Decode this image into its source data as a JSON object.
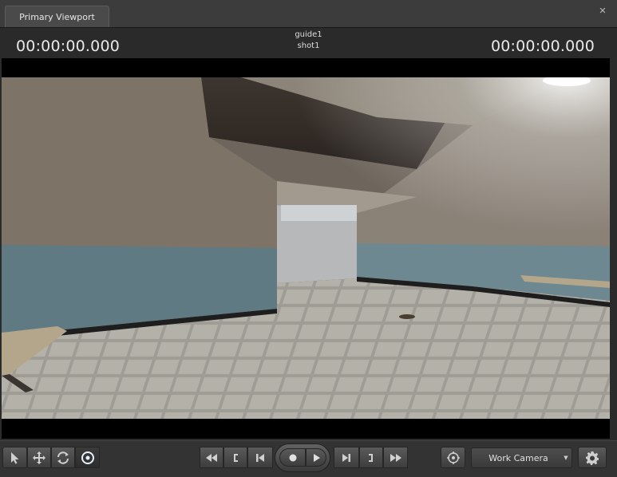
{
  "tab": {
    "title": "Primary Viewport"
  },
  "window": {
    "close_glyph": "✕"
  },
  "timecode": {
    "left": "00:00:00.000",
    "right": "00:00:00.000",
    "guide": "guide1",
    "shot": "shot1"
  },
  "toolbar": {
    "tools": [
      "select-arrow-icon",
      "move-icon",
      "rotate-icon",
      "target-icon"
    ],
    "transport": [
      "rewind-icon",
      "mark-in-icon",
      "step-back-icon",
      "record-icon",
      "play-icon",
      "step-forward-icon",
      "mark-out-icon",
      "fast-forward-icon"
    ],
    "camera_label": "Work Camera",
    "settings_icon": "gear-icon"
  },
  "colors": {
    "bg": "#2b2b2b",
    "panel": "#333333",
    "tab": "#4a4a4a"
  }
}
